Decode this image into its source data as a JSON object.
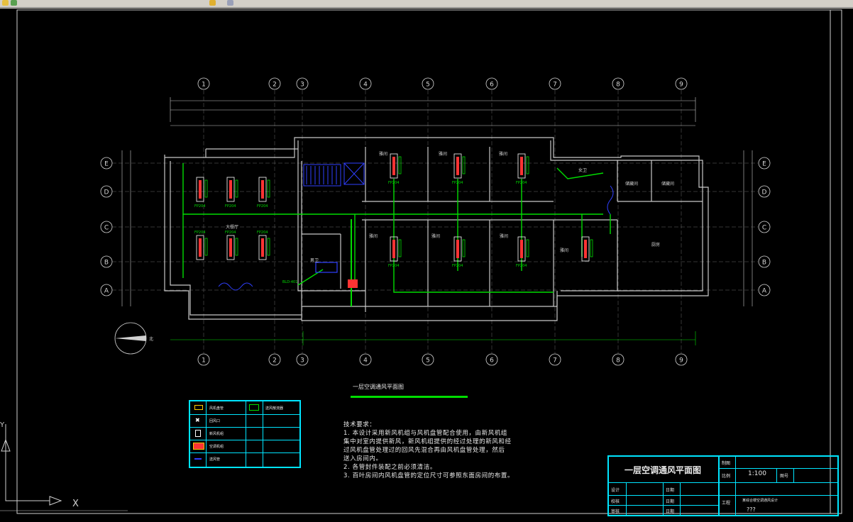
{
  "window": {
    "toolbar_icons": [
      "open-icon",
      "save-icon",
      "properties-icon",
      "layer-icon"
    ]
  },
  "colors": {
    "background": "#000000",
    "wall": "#c8c8c8",
    "duct": "#00dd00",
    "unit": "#ff3333",
    "grid_circle": "#d8d8d8",
    "table": "#00e5ff",
    "equipment": "#2f3fff"
  },
  "drawing": {
    "grid_columns": [
      "1",
      "2",
      "3",
      "4",
      "5",
      "6",
      "7",
      "8",
      "9"
    ],
    "grid_rows": [
      "E",
      "D",
      "C",
      "B",
      "A"
    ],
    "rooms": {
      "hall": "大餐厅",
      "office": "雅间",
      "kitchen": "厨房",
      "storage": "储藏间",
      "washroom": "卫生间",
      "women": "女卫",
      "men": "男卫"
    },
    "unit_label": "FP204",
    "ahu_label": "BLD-401",
    "north_label": "北",
    "plan_title": "一层空调通风平面图"
  },
  "legend": {
    "items": [
      {
        "icon": "fan-coil-icon",
        "label": "风机盘管",
        "icon2": "air-diffuser-icon",
        "label2": "送风散流器"
      },
      {
        "icon": "return-grille-icon",
        "label": "回风口",
        "icon2": "",
        "label2": ""
      },
      {
        "icon": "fresh-air-icon",
        "label": "新风机组",
        "icon2": "",
        "label2": ""
      },
      {
        "icon": "ahu-icon",
        "label": "空调机组",
        "icon2": "",
        "label2": ""
      },
      {
        "icon": "duct-icon",
        "label": "送风管",
        "icon2": "",
        "label2": ""
      }
    ]
  },
  "notes": {
    "heading": "技术要求：",
    "lines": [
      "1. 本设计采用新风机组与风机盘管配合使用，由新风机组",
      "集中对室内提供新风，新风机组提供的经过处理的新风和经",
      "过风机盘管处理过的回风先混合再由风机盘管处理，然后",
      "送入房间内。",
      "2. 各管封件装配之前必须清洁。",
      "3. 百叶房间内风机盘管的定位尺寸可参照东面房间的布置。"
    ]
  },
  "title_block": {
    "title": "一层空调通风平面图",
    "design": "设计",
    "check": "校核",
    "approve": "审核",
    "date": "日期",
    "scale_label": "比例",
    "scale": "1:100",
    "sheet_label": "图号",
    "project_label": "工程",
    "project_name": "某综合楼空调通风设计",
    "drawn": "制图",
    "code": "???"
  },
  "ucs": {
    "x_label": "X",
    "y_label": "Y"
  }
}
